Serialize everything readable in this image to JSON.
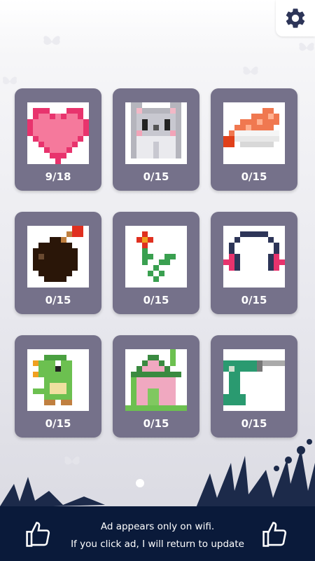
{
  "puzzles": [
    {
      "name": "heart",
      "progress": "9/18"
    },
    {
      "name": "cat",
      "progress": "0/15"
    },
    {
      "name": "sushi",
      "progress": "0/15"
    },
    {
      "name": "bomb",
      "progress": "0/15"
    },
    {
      "name": "flower",
      "progress": "0/15"
    },
    {
      "name": "headphones",
      "progress": "0/15"
    },
    {
      "name": "dinosaur",
      "progress": "0/15"
    },
    {
      "name": "house",
      "progress": "0/15"
    },
    {
      "name": "drill",
      "progress": "0/15"
    }
  ],
  "pagination": {
    "current_page": 1,
    "total_pages": 1
  },
  "ad": {
    "line1": "Ad appears only on wifi.",
    "line2": "If you click ad, I will return to update"
  },
  "icons": {
    "settings": "gear-icon",
    "ad_left": "thumbs-up-icon",
    "ad_right": "thumbs-up-icon"
  },
  "colors": {
    "card": "#75718a",
    "ad_bar": "#0a1a3a",
    "heart": "#e8336d",
    "heart_light": "#f5799c"
  }
}
